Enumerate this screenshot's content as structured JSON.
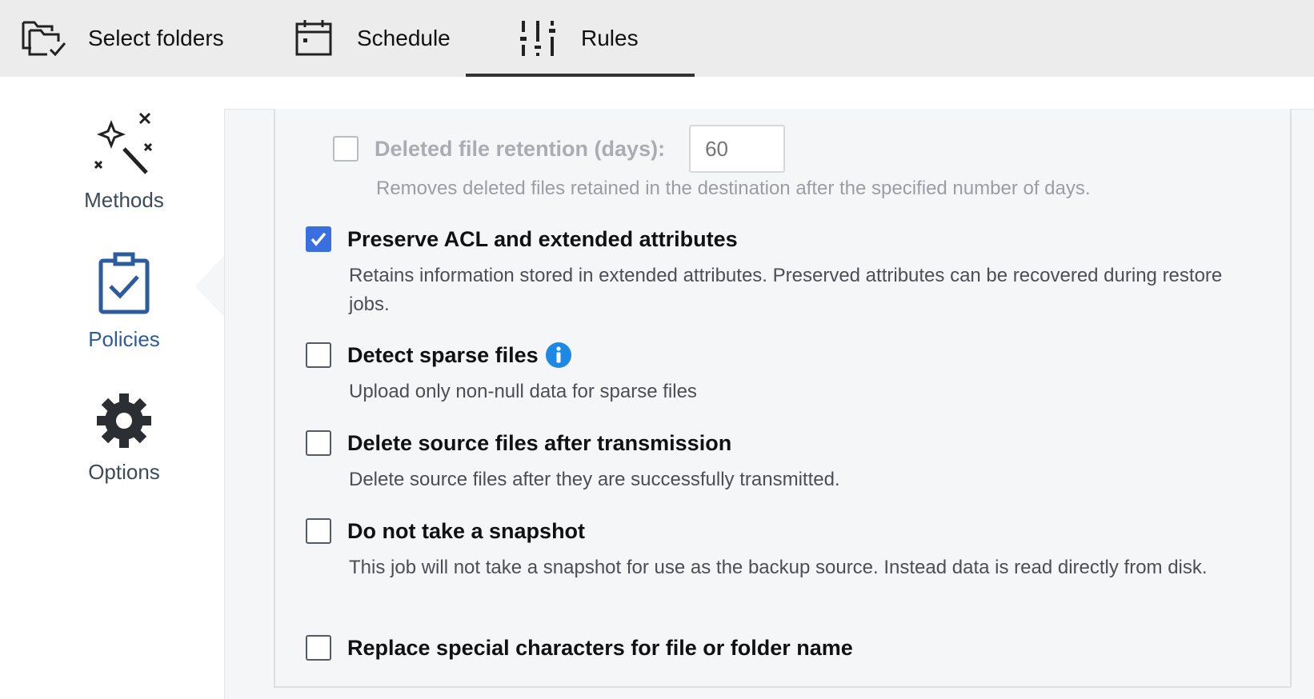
{
  "tabs": [
    {
      "id": "select",
      "label": "Select folders",
      "icon": "folder-check-icon",
      "active": false
    },
    {
      "id": "schedule",
      "label": "Schedule",
      "icon": "calendar-icon",
      "active": false
    },
    {
      "id": "rules",
      "label": "Rules",
      "icon": "sliders-icon",
      "active": true
    }
  ],
  "sidenav": {
    "methods": {
      "label": "Methods",
      "icon": "magic-wand-icon"
    },
    "policies": {
      "label": "Policies",
      "icon": "clipboard-check-icon",
      "active": true
    },
    "options": {
      "label": "Options",
      "icon": "gear-icon"
    }
  },
  "policies": {
    "retention": {
      "title": "Deleted file retention (days):",
      "placeholder": "60",
      "desc": "Removes deleted files retained in the destination after the specified number of days.",
      "checked": false,
      "disabled": true
    },
    "acl": {
      "title": "Preserve ACL and extended attributes",
      "desc": "Retains information stored in extended attributes. Preserved attributes can be recovered during restore jobs.",
      "checked": true
    },
    "sparse": {
      "title": "Detect sparse files",
      "desc": "Upload only non-null data for sparse files",
      "checked": false,
      "icon": "info-icon"
    },
    "delete_source": {
      "title": "Delete source files after transmission",
      "desc": "Delete source files after they are successfully transmitted.",
      "checked": false
    },
    "no_snapshot": {
      "title": "Do not take a snapshot",
      "desc": "This job will not take a snapshot for use as the backup source. Instead data is read directly from disk.",
      "checked": false
    },
    "replace_chars": {
      "title": "Replace special characters for file or folder name",
      "checked": false
    }
  },
  "colors": {
    "accent": "#3b6fe0",
    "active_nav": "#2c5c9e",
    "info": "#1e88e5"
  }
}
